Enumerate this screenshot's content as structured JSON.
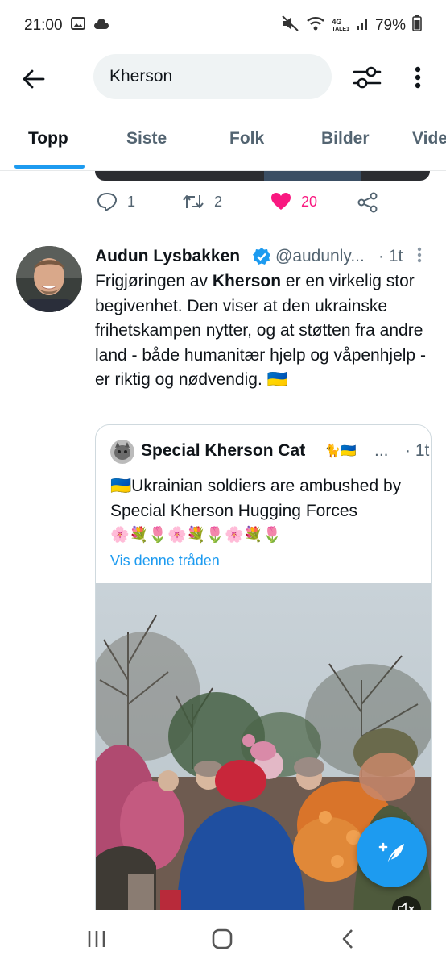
{
  "status_bar": {
    "time": "21:00",
    "network": "4G",
    "network_sub": "TALE1",
    "battery": "79%"
  },
  "search": {
    "query": "Kherson",
    "icons": [
      "back-arrow-icon",
      "filter-sliders-icon",
      "more-vertical-icon"
    ]
  },
  "tabs": [
    {
      "label": "Topp",
      "active": true
    },
    {
      "label": "Siste",
      "active": false
    },
    {
      "label": "Folk",
      "active": false
    },
    {
      "label": "Bilder",
      "active": false
    },
    {
      "label": "Video",
      "active": false
    }
  ],
  "previous_tweet": {
    "replies": "1",
    "retweets": "2",
    "likes": "20",
    "liked": true
  },
  "tweet": {
    "author_name": "Audun Lysbakken",
    "verified": true,
    "handle": "@audunly...",
    "time": "· 1t",
    "body_pre": "Frigjøringen av ",
    "body_bold": "Kherson",
    "body_post": " er en virkelig stor begivenhet. Den viser at den ukrainske frihetskampen nytter, og at støtten fra andre land - både humanitær hjelp og våpenhjelp - er riktig og nødvendig. 🇺🇦",
    "quote": {
      "author_name": "Special Kherson Cat",
      "name_emoji": "🐈🇺🇦",
      "ellipsis": "...",
      "time": "· 1t",
      "text": "🇺🇦Ukrainian soldiers are ambushed by Special Kherson Hugging Forces",
      "flowers": "🌸💐🌷🌸💐🌷🌸💐🌷",
      "thread_link": "Vis denne tråden"
    }
  },
  "colors": {
    "accent": "#1d9bf0",
    "like": "#f91880",
    "text": "#0f1419",
    "secondary_text": "#536471"
  }
}
